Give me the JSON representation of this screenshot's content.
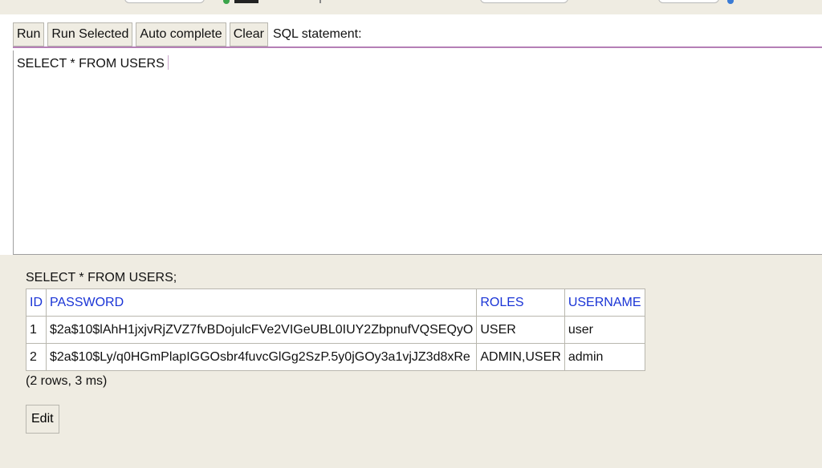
{
  "toolbar": {
    "run": "Run",
    "run_selected": "Run Selected",
    "auto_complete": "Auto complete",
    "clear": "Clear",
    "sql_label": "SQL statement:"
  },
  "editor": {
    "text": "SELECT * FROM USERS"
  },
  "result": {
    "query": "SELECT * FROM USERS;",
    "columns": [
      "ID",
      "PASSWORD",
      "ROLES",
      "USERNAME"
    ],
    "rows": [
      [
        "1",
        "$2a$10$lAhH1jxjvRjZVZ7fvBDojulcFVe2VIGeUBL0IUY2ZbpnufVQSEQyO",
        "USER",
        "user"
      ],
      [
        "2",
        "$2a$10$Ly/q0HGmPlapIGGOsbr4fuvcGlGg2SzP.5y0jGOy3a1vjJZ3d8xRe",
        "ADMIN,USER",
        "admin"
      ]
    ],
    "summary": "(2 rows, 3 ms)",
    "edit_label": "Edit"
  },
  "colors": {
    "background": "#efece2",
    "header_link": "#1a34d6",
    "editor_border_accent": "#b57fb6"
  }
}
